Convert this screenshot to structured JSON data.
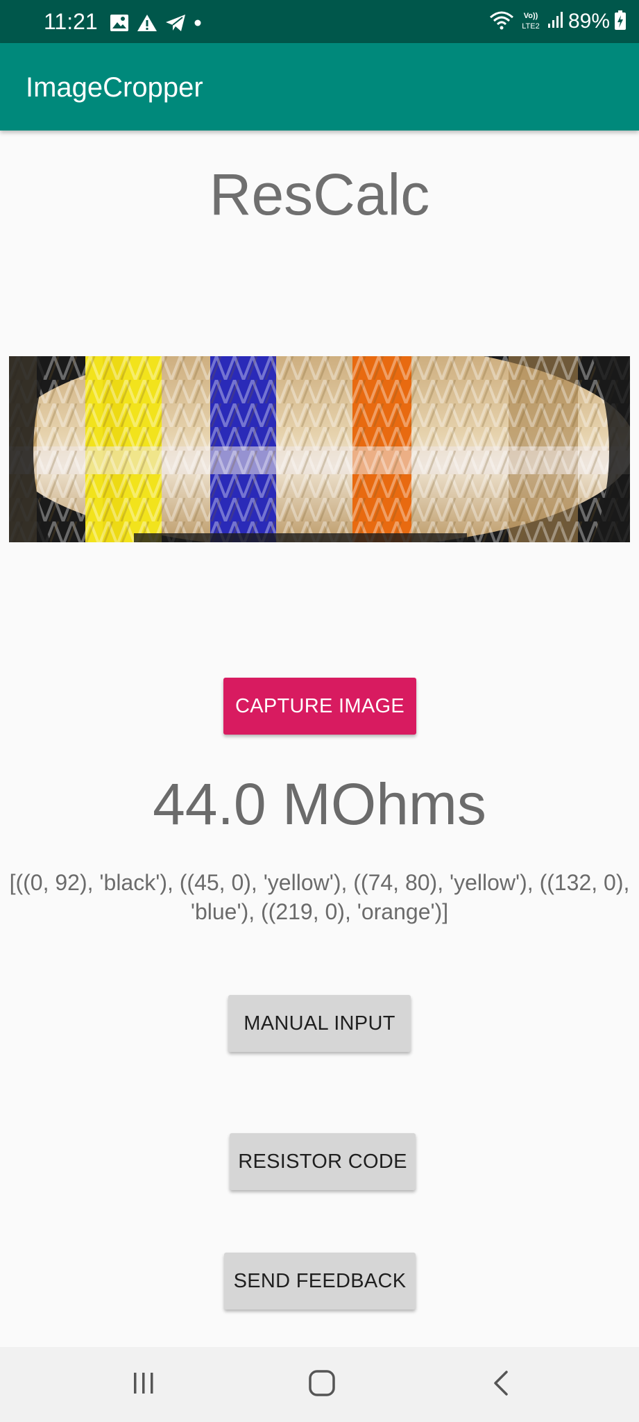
{
  "status_bar": {
    "time": "11:21",
    "left_icons": [
      "gallery-icon",
      "warning-icon",
      "telegram-icon",
      "dot-icon"
    ],
    "network": "Vo)) LTE2",
    "battery_percent": "89%",
    "right_icons": [
      "wifi-icon",
      "volte-icon",
      "signal-icon",
      "battery-charging-icon"
    ]
  },
  "app_bar": {
    "title": "ImageCropper"
  },
  "main": {
    "title": "ResCalc",
    "capture_button_label": "CAPTURE IMAGE",
    "result_value": "44.0 MOhms",
    "result_detail": "[((0, 92), 'black'), ((45, 0), 'yellow'), ((74, 80), 'yellow'), ((132, 0), 'blue'), ((219, 0), 'orange')]",
    "manual_input_label": "MANUAL INPUT",
    "resistor_code_label": "RESISTOR CODE",
    "send_feedback_label": "SEND FEEDBACK"
  },
  "nav_bar": {
    "icons": [
      "recent-apps-icon",
      "home-icon",
      "back-icon"
    ]
  },
  "colors": {
    "status_bar": "#00574b",
    "app_bar": "#00897b",
    "accent": "#d81b60",
    "button_grey": "#d6d6d6",
    "text_grey": "#6b6b6b",
    "background": "#fafafa"
  }
}
